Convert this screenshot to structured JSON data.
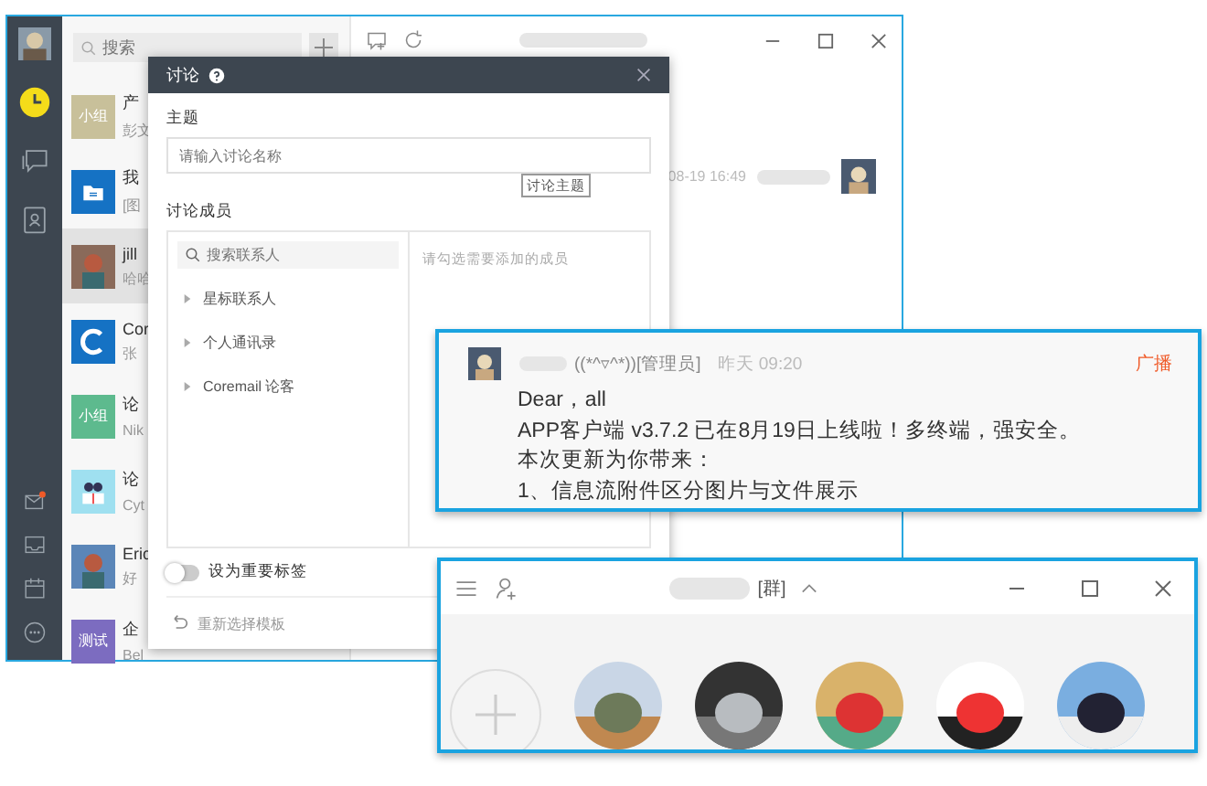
{
  "main_window": {
    "search": {
      "placeholder": "搜索"
    },
    "conversations": [
      {
        "kind": "text",
        "avatar_text": "小组",
        "color": "#c8c09a",
        "title": "产",
        "preview": "彭文",
        "selected": false
      },
      {
        "kind": "folder",
        "color": "#1572c4",
        "title": "我",
        "preview": "[图",
        "selected": false
      },
      {
        "color": "#8a6a5a",
        "title": "jill",
        "preview": "哈哈",
        "selected": true
      },
      {
        "kind": "logo",
        "color": "#1572c4",
        "title": "Cor",
        "preview": "张",
        "selected": false
      },
      {
        "kind": "text",
        "avatar_text": "小组",
        "color": "#5dba8e",
        "title": "论",
        "preview": "Nik",
        "selected": false
      },
      {
        "kind": "people",
        "color": "#9fe0f0",
        "title": "论",
        "preview": "Cyt",
        "selected": false
      },
      {
        "color": "#5b86b8",
        "title": "Eric",
        "preview": "好",
        "selected": false
      },
      {
        "kind": "text",
        "avatar_text": "测试",
        "color": "#7c6cc0",
        "title": "企",
        "preview": "Bel",
        "selected": false
      }
    ],
    "message": {
      "time": "08-19 16:49"
    }
  },
  "dialog": {
    "title": "讨论",
    "topic_label": "主题",
    "topic": {
      "placeholder": "请输入讨论名称"
    },
    "tooltip": "讨论主题",
    "members_label": "讨论成员",
    "contact_search": {
      "placeholder": "搜索联系人"
    },
    "groups": [
      {
        "label": "星标联系人",
        "expanded": false
      },
      {
        "label": "个人通讯录",
        "expanded": false
      },
      {
        "label": "Coremail 论客",
        "expanded": false
      }
    ],
    "selected_hint": "请勾选需要添加的成员",
    "important_toggle": {
      "label": "设为重要标签",
      "on": false
    },
    "reselect": "重新选择模板"
  },
  "broadcast": {
    "sender": "((*^▿^*))[管理员]",
    "time": "昨天 09:20",
    "tag": "广播",
    "lines": [
      "Dear，all",
      "APP客户端 v3.7.2 已在8月19日上线啦！多终端，强安全。",
      "本次更新为你带来：",
      "1、信息流附件区分图片与文件展示"
    ]
  },
  "group_window": {
    "title_tag": "[群]"
  }
}
